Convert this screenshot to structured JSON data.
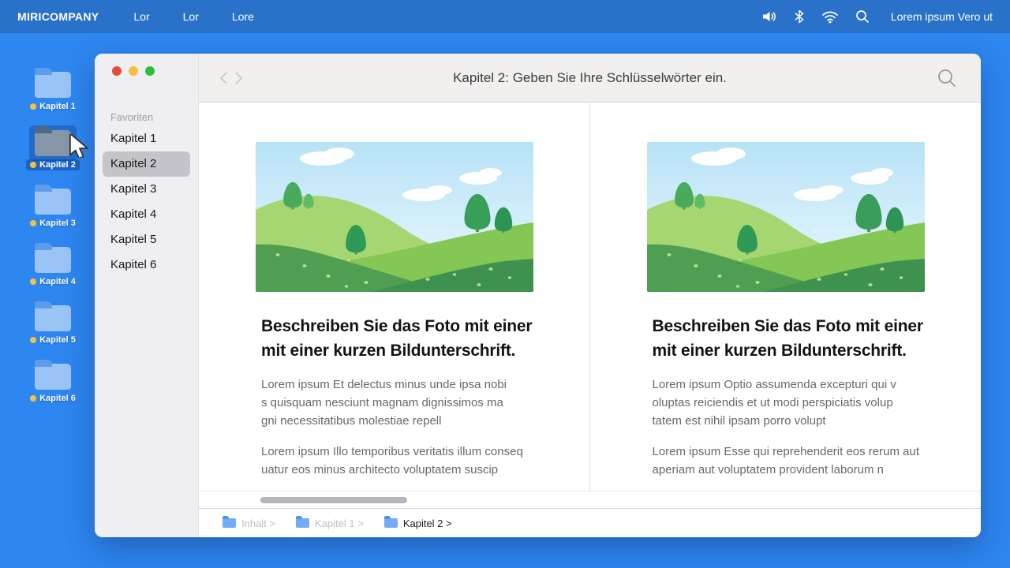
{
  "menu_bar": {
    "brand": "MIRICOMPANY",
    "menus": [
      {
        "label": "Lor"
      },
      {
        "label": "Lor"
      },
      {
        "label": "Lore"
      }
    ],
    "status_text": "Lorem ipsum Vero ut"
  },
  "desktop": {
    "icons": [
      {
        "label": "Kapitel 1"
      },
      {
        "label": "Kapitel 2"
      },
      {
        "label": "Kapitel 3"
      },
      {
        "label": "Kapitel 4"
      },
      {
        "label": "Kapitel 5"
      },
      {
        "label": "Kapitel 6"
      }
    ],
    "selected_icon": "Kapitel 2"
  },
  "window": {
    "sidebar": {
      "section_label": "Favoriten",
      "items": [
        {
          "label": "Kapitel 1"
        },
        {
          "label": "Kapitel 2"
        },
        {
          "label": "Kapitel 3"
        },
        {
          "label": "Kapitel 4"
        },
        {
          "label": "Kapitel 5"
        },
        {
          "label": "Kapitel 6"
        }
      ],
      "selected_item": "Kapitel 2"
    },
    "toolbar": {
      "title": "Kapitel 2: Geben Sie Ihre Schlüsselwörter ein."
    },
    "columns": [
      {
        "heading": [
          "Beschreiben Sie das Foto mit einer",
          "mit einer kurzen Bildunterschrift."
        ],
        "paragraph1": [
          "Lorem ipsum Et delectus minus unde ipsa nobi",
          "s quisquam nesciunt magnam dignissimos ma",
          "gni necessitatibus molestiae repell"
        ],
        "paragraph2": [
          "Lorem ipsum Illo temporibus veritatis illum conseq",
          "uatur eos minus architecto voluptatem suscip"
        ]
      },
      {
        "heading": [
          "Beschreiben Sie das Foto mit einer",
          "mit einer kurzen Bildunterschrift."
        ],
        "paragraph1": [
          "Lorem ipsum Optio assumenda excepturi qui v",
          "oluptas reiciendis et ut modi perspiciatis volup",
          "tatem est nihil ipsam porro volupt"
        ],
        "paragraph2": [
          "Lorem ipsum Esse qui reprehenderit eos rerum aut",
          "aperiam aut voluptatem provident laborum n"
        ]
      }
    ],
    "breadcrumbs": [
      {
        "label": "Inhalt >"
      },
      {
        "label": "Kapitel 1 >"
      },
      {
        "label": "Kapitel 2 >"
      }
    ]
  },
  "colors": {
    "menu_bar": "#2971c9",
    "desktop": "#2e86f0",
    "selection_blue": "#1c63c4",
    "folder_blue": "#9ac4f6",
    "status_dot_yellow": "#f3c13f",
    "sidebar_gray": "#efeef1",
    "toolbar_gray": "#f1f0ee"
  }
}
